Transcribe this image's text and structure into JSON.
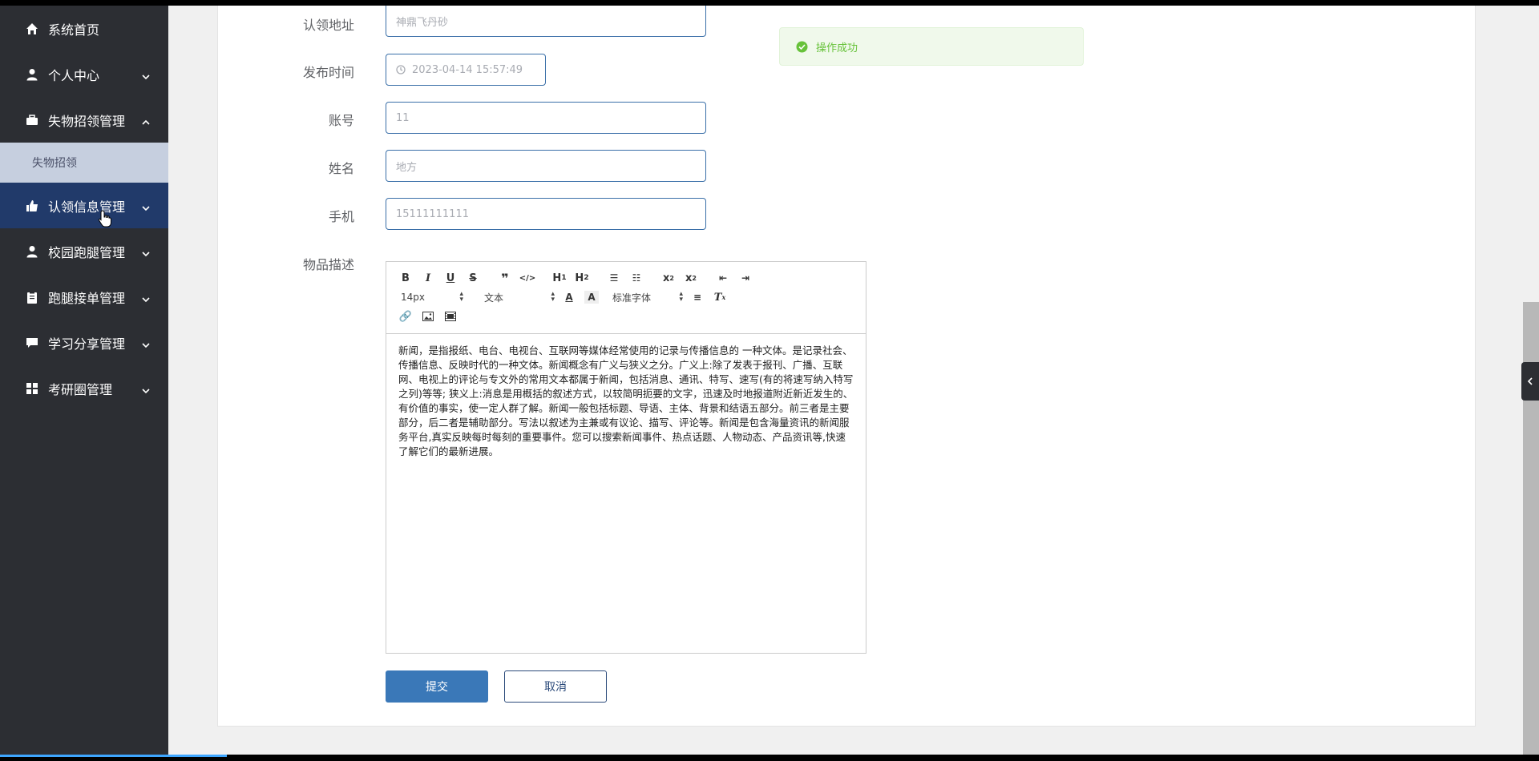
{
  "sidebar": {
    "items": [
      {
        "label": "系统首页",
        "icon": "home-icon"
      },
      {
        "label": "个人中心",
        "icon": "user-icon"
      },
      {
        "label": "失物招领管理",
        "icon": "briefcase-icon"
      },
      {
        "label": "认领信息管理",
        "icon": "thumbs-up-icon"
      },
      {
        "label": "校园跑腿管理",
        "icon": "user-icon"
      },
      {
        "label": "跑腿接单管理",
        "icon": "clipboard-icon"
      },
      {
        "label": "学习分享管理",
        "icon": "comment-icon"
      },
      {
        "label": "考研圈管理",
        "icon": "grid-icon"
      }
    ],
    "submenu": {
      "label": "失物招领"
    }
  },
  "form": {
    "address": {
      "label": "认领地址",
      "value": "神鼎飞丹砂"
    },
    "publish_time": {
      "label": "发布时间",
      "value": "2023-04-14 15:57:49"
    },
    "account": {
      "label": "账号",
      "value": "11"
    },
    "name": {
      "label": "姓名",
      "value": "地方"
    },
    "phone": {
      "label": "手机",
      "value": "15111111111"
    },
    "description": {
      "label": "物品描述",
      "content": "新闻，是指报纸、电台、电视台、互联网等媒体经常使用的记录与传播信息的 一种文体。是记录社会、传播信息、反映时代的一种文体。新闻概念有广义与狭义之分。广义上:除了发表于报刊、广播、互联网、电视上的评论与专文外的常用文本都属于新闻，包括消息、通讯、特写、速写(有的将速写纳入特写之列)等等; 狭义上:消息是用概括的叙述方式，以较简明扼要的文字，迅速及时地报道附近新近发生的、有价值的事实，使一定人群了解。新闻一般包括标题、导语、主体、背景和结语五部分。前三者是主要部分，后二者是辅助部分。写法以叙述为主兼或有议论、描写、评论等。新闻是包含海量资讯的新闻服务平台,真实反映每时每刻的重要事件。您可以搜索新闻事件、热点话题、人物动态、产品资讯等,快速了解它们的最新进展。"
    }
  },
  "editor": {
    "font_size": "14px",
    "text_type": "文本",
    "font_family": "标准字体"
  },
  "buttons": {
    "submit": "提交",
    "cancel": "取消"
  },
  "toast": {
    "message": "操作成功"
  },
  "colors": {
    "sidebar_bg": "#2c2e33",
    "active_bg": "#213a6a",
    "primary": "#3a78b8",
    "success": "#67c23a"
  }
}
